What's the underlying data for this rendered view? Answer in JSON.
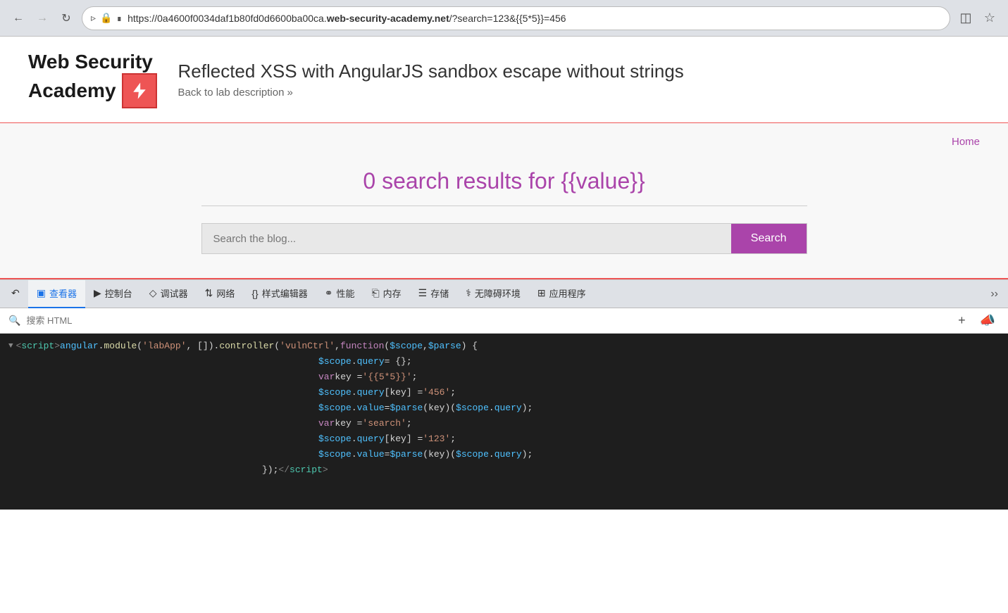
{
  "browser": {
    "back_disabled": false,
    "forward_disabled": true,
    "url_prefix": "https://0a4600f0034daf1b80fd0d6600ba00ca.",
    "url_domain": "web-security-academy.net",
    "url_suffix": "/?search=123&{{5*5}}=456",
    "extensions_icon": "⊞",
    "star_icon": "☆"
  },
  "site_header": {
    "logo_line1": "Web Security",
    "logo_line2": "Academy",
    "page_title": "Reflected XSS with AngularJS sandbox escape without strings",
    "back_link": "Back to lab description",
    "back_arrow": "»"
  },
  "lab": {
    "nav_home": "Home",
    "search_results": "0 search results for {{value}}",
    "search_placeholder": "Search the blog...",
    "search_button": "Search"
  },
  "devtools": {
    "tabs": [
      {
        "id": "pointer",
        "label": "",
        "icon": "⇱"
      },
      {
        "id": "inspector",
        "label": "查看器",
        "icon": "☐",
        "active": true
      },
      {
        "id": "console",
        "label": "控制台",
        "icon": "▷"
      },
      {
        "id": "debugger",
        "label": "调试器",
        "icon": "◇"
      },
      {
        "id": "network",
        "label": "网络",
        "icon": "↑↓"
      },
      {
        "id": "style-editor",
        "label": "样式编辑器",
        "icon": "{}"
      },
      {
        "id": "performance",
        "label": "性能",
        "icon": "◯"
      },
      {
        "id": "memory",
        "label": "内存",
        "icon": "⊏"
      },
      {
        "id": "storage",
        "label": "存储",
        "icon": "≡"
      },
      {
        "id": "accessibility",
        "label": "无障碍环境",
        "icon": "♿"
      },
      {
        "id": "application",
        "label": "应用程序",
        "icon": "⊞"
      }
    ],
    "search_placeholder": "搜索 HTML",
    "add_button": "+",
    "eyedropper_button": "⌗"
  },
  "code": {
    "line1": "<script>angular.module('labApp', []).controller('vulnCtrl',function($scope, $parse) {",
    "line2_indent": "$scope.query = {};",
    "line3_indent": "var key = '{{5*5}}';",
    "line4_indent": "$scope.query[key] = '456';",
    "line5_indent": "$scope.value = $parse(key)($scope.query);",
    "line6_indent": "var key = 'search';",
    "line7_indent": "$scope.query[key] = '123';",
    "line8_indent": "$scope.value = $parse(key)($scope.query);",
    "line9_indent": "});</script>"
  }
}
